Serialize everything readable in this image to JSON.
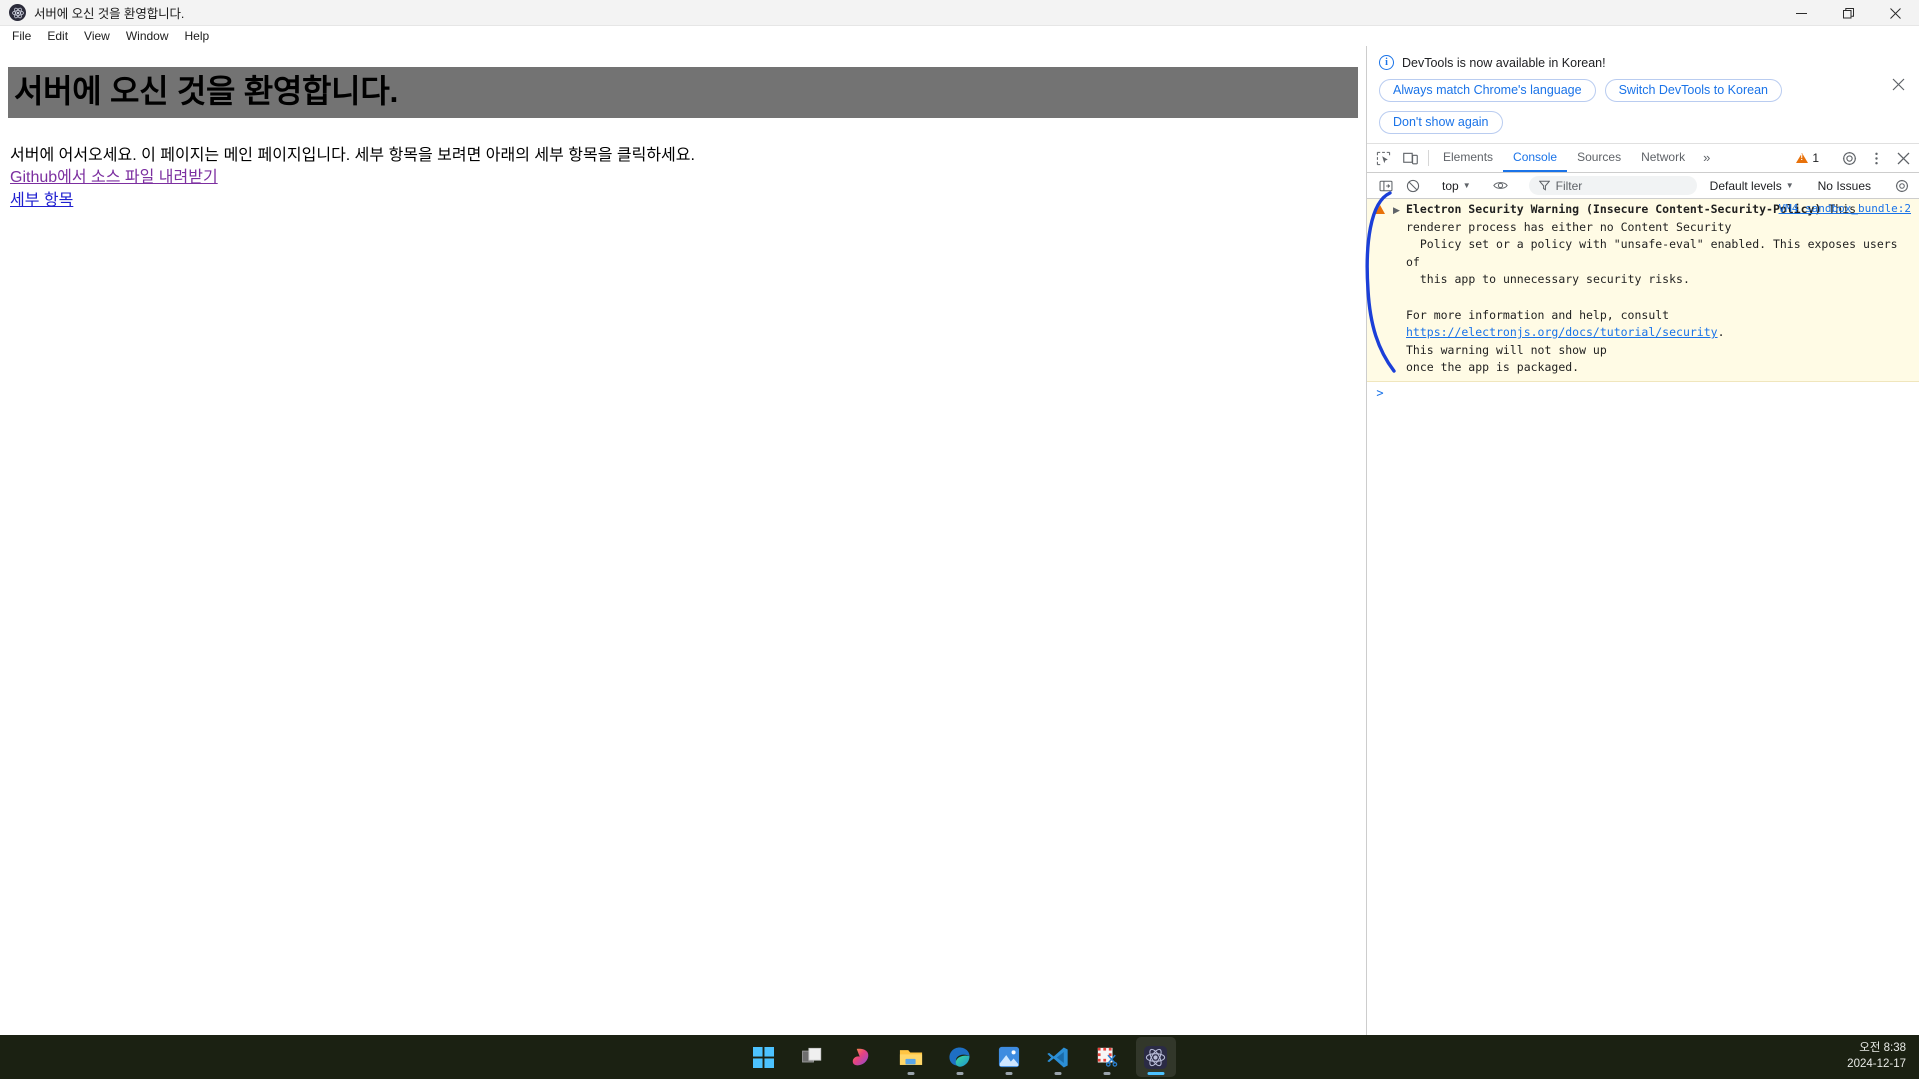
{
  "window": {
    "title": "서버에 오신 것을 환영합니다.",
    "app_icon": "electron-icon",
    "controls": {
      "minimize": "minimize-icon",
      "restore": "restore-icon",
      "close": "close-icon"
    }
  },
  "menubar": {
    "items": [
      {
        "label": "File"
      },
      {
        "label": "Edit"
      },
      {
        "label": "View"
      },
      {
        "label": "Window"
      },
      {
        "label": "Help"
      }
    ]
  },
  "page": {
    "heading": "서버에 오신 것을 환영합니다.",
    "paragraph": "서버에 어서오세요. 이 페이지는 메인 페이지입니다. 세부 항목을 보려면 아래의 세부 항목을 클릭하세요.",
    "links": [
      {
        "label": "Github에서 소스 파일 내려받기",
        "state": "visited"
      },
      {
        "label": "세부 항목",
        "state": "unvisited"
      }
    ],
    "heading_bg_color": "#737373"
  },
  "devtools": {
    "notification": {
      "icon": "info-icon",
      "message": "DevTools is now available in Korean!",
      "buttons": [
        {
          "label": "Always match Chrome's language"
        },
        {
          "label": "Switch DevTools to Korean"
        },
        {
          "label": "Don't show again"
        }
      ],
      "close_icon": "close-icon"
    },
    "tabbar": {
      "left_icons": [
        {
          "name": "inspect-element-icon"
        },
        {
          "name": "device-toolbar-icon"
        }
      ],
      "tabs": [
        {
          "label": "Elements",
          "active": false
        },
        {
          "label": "Console",
          "active": true
        },
        {
          "label": "Sources",
          "active": false
        },
        {
          "label": "Network",
          "active": false
        }
      ],
      "more_tabs_label": "»",
      "warning_count": "1",
      "settings_icon": "gear-icon",
      "more_options_icon": "kebab-menu-icon",
      "close_icon": "close-icon",
      "accent_color": "#1a73e8"
    },
    "console_toolbar": {
      "sidebar_toggle_icon": "console-sidebar-icon",
      "clear_icon": "clear-console-icon",
      "context": "top",
      "eye_icon": "live-expression-icon",
      "filter_icon": "filter-icon",
      "filter_placeholder": "Filter",
      "filter_value": "",
      "levels": "Default levels",
      "issues": "No Issues",
      "settings_icon": "gear-icon"
    },
    "console_messages": [
      {
        "level": "warning",
        "source": "VM4 sandbox_bundle:2",
        "title": "Electron Security Warning (Insecure Content-Security-Policy)",
        "body_line1": " This",
        "body_rest": "renderer process has either no Content Security\n  Policy set or a policy with \"unsafe-eval\" enabled. This exposes users of\n  this app to unnecessary security risks.",
        "body_after": "For more information and help, consult",
        "link": "https://electronjs.org/docs/tutorial/security",
        "body_tail": ".\nThis warning will not show up\nonce the app is packaged."
      }
    ],
    "prompt_caret": ">"
  },
  "taskbar": {
    "items": [
      {
        "name": "start-button",
        "label": "Start",
        "running": false,
        "active": false
      },
      {
        "name": "task-view-button",
        "label": "Task View",
        "running": false,
        "active": false
      },
      {
        "name": "copilot-button",
        "label": "Copilot",
        "running": false,
        "active": false
      },
      {
        "name": "file-explorer-button",
        "label": "File Explorer",
        "running": true,
        "active": false
      },
      {
        "name": "edge-button",
        "label": "Microsoft Edge",
        "running": true,
        "active": false
      },
      {
        "name": "photos-button",
        "label": "Photos",
        "running": true,
        "active": false
      },
      {
        "name": "vscode-button",
        "label": "Visual Studio Code",
        "running": true,
        "active": false
      },
      {
        "name": "snipping-tool-button",
        "label": "Snipping Tool",
        "running": true,
        "active": false
      },
      {
        "name": "electron-app-button",
        "label": "Electron App",
        "running": true,
        "active": true
      }
    ],
    "clock": {
      "time": "오전 8:38",
      "date": "2024-12-17"
    },
    "background_color": "#1b2112"
  }
}
